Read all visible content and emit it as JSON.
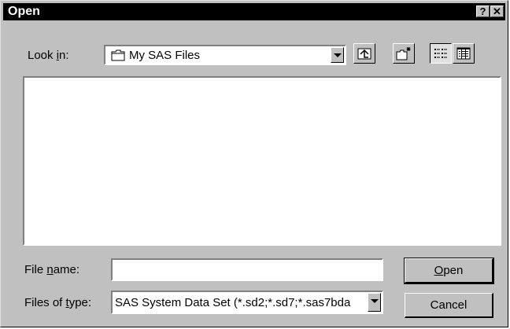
{
  "window": {
    "title": "Open",
    "help_glyph": "?",
    "close_glyph": "✕"
  },
  "look_in": {
    "label_before": "Look ",
    "label_accel": "i",
    "label_after": "n:",
    "value": "My SAS Files",
    "icon": "folder-icon"
  },
  "toolbar": {
    "buttons": [
      "up-one-level-icon",
      "create-new-folder-icon",
      "list-view-icon",
      "details-view-icon"
    ],
    "pressed": "list-view-icon"
  },
  "file_name": {
    "label_before": "File ",
    "label_accel": "n",
    "label_after": "ame:",
    "value": ""
  },
  "file_type": {
    "label_before": "Files of ",
    "label_accel": "t",
    "label_after": "ype:",
    "value": "SAS System Data Set (*.sd2;*.sd7;*.sas7bda"
  },
  "buttons": {
    "open_accel": "O",
    "open_rest": "pen",
    "cancel": "Cancel"
  }
}
